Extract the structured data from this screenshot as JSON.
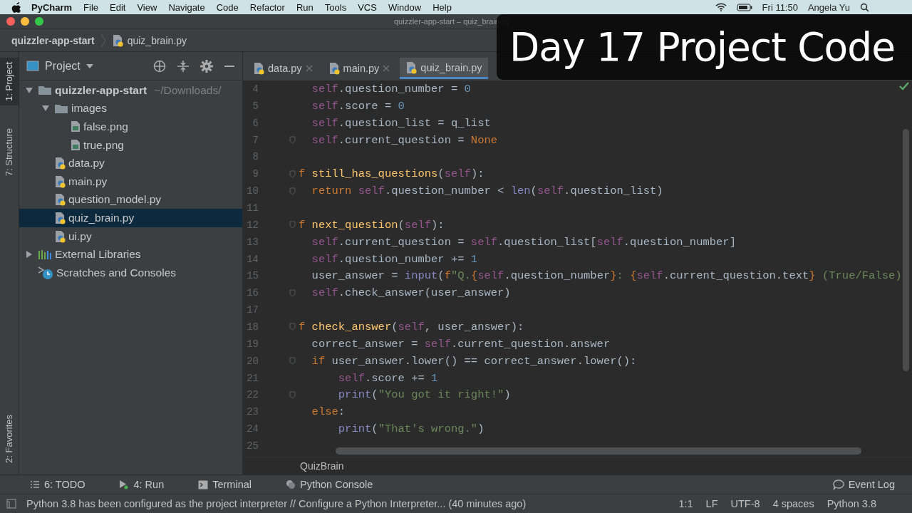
{
  "menubar": {
    "app": "PyCharm",
    "menus": [
      "File",
      "Edit",
      "View",
      "Navigate",
      "Code",
      "Refactor",
      "Run",
      "Tools",
      "VCS",
      "Window",
      "Help"
    ],
    "clock": "Fri 11:50",
    "user": "Angela Yu"
  },
  "window": {
    "title": "quizzler-app-start – quiz_brain.py"
  },
  "breadcrumb": [
    "quizzler-app-start",
    "quiz_brain.py"
  ],
  "side_tabs": [
    {
      "label": "1: Project",
      "kind": "top",
      "selected": true
    },
    {
      "label": "7: Structure",
      "kind": "top",
      "selected": false
    },
    {
      "label": "2: Favorites",
      "kind": "bottom",
      "selected": false
    }
  ],
  "project": {
    "title": "Project",
    "tree": [
      {
        "name": "quizzler-app-start",
        "hint": "~/Downloads/",
        "kind": "folder",
        "expanded": true,
        "selected": false,
        "children": [
          {
            "name": "images",
            "kind": "folder",
            "expanded": true,
            "selected": false,
            "children": [
              {
                "name": "false.png",
                "kind": "image",
                "selected": false
              },
              {
                "name": "true.png",
                "kind": "image",
                "selected": false
              }
            ]
          },
          {
            "name": "data.py",
            "kind": "python",
            "selected": false
          },
          {
            "name": "main.py",
            "kind": "python",
            "selected": false
          },
          {
            "name": "question_model.py",
            "kind": "python",
            "selected": false
          },
          {
            "name": "quiz_brain.py",
            "kind": "python",
            "selected": true
          },
          {
            "name": "ui.py",
            "kind": "python",
            "selected": false
          }
        ]
      },
      {
        "name": "External Libraries",
        "kind": "library",
        "expanded": false,
        "selected": false
      },
      {
        "name": "Scratches and Consoles",
        "kind": "scratches",
        "selected": false
      }
    ]
  },
  "editor": {
    "tabs": [
      {
        "label": "data.py",
        "selected": false
      },
      {
        "label": "main.py",
        "selected": false
      },
      {
        "label": "quiz_brain.py",
        "selected": true
      }
    ],
    "lines": [
      {
        "number": "4",
        "fold": false,
        "tokens": [
          {
            "kind": "self",
            "text": "  self"
          },
          {
            "kind": "plain",
            "text": ".question_number = "
          },
          {
            "kind": "number",
            "text": "0"
          }
        ]
      },
      {
        "number": "5",
        "fold": false,
        "tokens": [
          {
            "kind": "self",
            "text": "  self"
          },
          {
            "kind": "plain",
            "text": ".score = "
          },
          {
            "kind": "number",
            "text": "0"
          }
        ]
      },
      {
        "number": "6",
        "fold": false,
        "tokens": [
          {
            "kind": "self",
            "text": "  self"
          },
          {
            "kind": "plain",
            "text": ".question_list = q_list"
          }
        ]
      },
      {
        "number": "7",
        "fold": true,
        "tokens": [
          {
            "kind": "self",
            "text": "  self"
          },
          {
            "kind": "plain",
            "text": ".current_question = "
          },
          {
            "kind": "keyword",
            "text": "None"
          }
        ]
      },
      {
        "number": "8",
        "fold": false
      },
      {
        "number": "9",
        "fold": true,
        "tokens": [
          {
            "kind": "keyword",
            "text": "f "
          },
          {
            "kind": "defname",
            "text": "still_has_questions"
          },
          {
            "kind": "plain",
            "text": "("
          },
          {
            "kind": "self",
            "text": "self"
          },
          {
            "kind": "plain",
            "text": "):"
          }
        ]
      },
      {
        "number": "10",
        "fold": true,
        "tokens": [
          {
            "kind": "keyword",
            "text": "  return "
          },
          {
            "kind": "self",
            "text": "self"
          },
          {
            "kind": "plain",
            "text": ".question_number < "
          },
          {
            "kind": "builtin",
            "text": "len"
          },
          {
            "kind": "plain",
            "text": "("
          },
          {
            "kind": "self",
            "text": "self"
          },
          {
            "kind": "plain",
            "text": ".question_list)"
          }
        ]
      },
      {
        "number": "11",
        "fold": false
      },
      {
        "number": "12",
        "fold": true,
        "tokens": [
          {
            "kind": "keyword",
            "text": "f "
          },
          {
            "kind": "defname",
            "text": "next_question"
          },
          {
            "kind": "plain",
            "text": "("
          },
          {
            "kind": "self",
            "text": "self"
          },
          {
            "kind": "plain",
            "text": "):"
          }
        ]
      },
      {
        "number": "13",
        "fold": false,
        "tokens": [
          {
            "kind": "self",
            "text": "  self"
          },
          {
            "kind": "plain",
            "text": ".current_question = "
          },
          {
            "kind": "self",
            "text": "self"
          },
          {
            "kind": "plain",
            "text": ".question_list["
          },
          {
            "kind": "self",
            "text": "self"
          },
          {
            "kind": "plain",
            "text": ".question_number]"
          }
        ]
      },
      {
        "number": "14",
        "fold": false,
        "tokens": [
          {
            "kind": "self",
            "text": "  self"
          },
          {
            "kind": "plain",
            "text": ".question_number += "
          },
          {
            "kind": "number",
            "text": "1"
          }
        ]
      },
      {
        "number": "15",
        "fold": false,
        "tokens": [
          {
            "kind": "plain",
            "text": "  user_answer = "
          },
          {
            "kind": "builtin",
            "text": "input"
          },
          {
            "kind": "plain",
            "text": "("
          },
          {
            "kind": "keyword",
            "text": "f"
          },
          {
            "kind": "string",
            "text": "\"Q."
          },
          {
            "kind": "keyword",
            "text": "{"
          },
          {
            "kind": "self",
            "text": "self"
          },
          {
            "kind": "plain",
            "text": ".question_number"
          },
          {
            "kind": "keyword",
            "text": "}"
          },
          {
            "kind": "string",
            "text": ": "
          },
          {
            "kind": "keyword",
            "text": "{"
          },
          {
            "kind": "self",
            "text": "self"
          },
          {
            "kind": "plain",
            "text": ".current_question.text"
          },
          {
            "kind": "keyword",
            "text": "}"
          },
          {
            "kind": "string",
            "text": " (True/False)"
          }
        ]
      },
      {
        "number": "16",
        "fold": true,
        "tokens": [
          {
            "kind": "self",
            "text": "  self"
          },
          {
            "kind": "plain",
            "text": ".check_answer(user_answer)"
          }
        ]
      },
      {
        "number": "17",
        "fold": false
      },
      {
        "number": "18",
        "fold": true,
        "tokens": [
          {
            "kind": "keyword",
            "text": "f "
          },
          {
            "kind": "defname",
            "text": "check_answer"
          },
          {
            "kind": "plain",
            "text": "("
          },
          {
            "kind": "self",
            "text": "self"
          },
          {
            "kind": "plain",
            "text": ", user_answer):"
          }
        ]
      },
      {
        "number": "19",
        "fold": false,
        "tokens": [
          {
            "kind": "plain",
            "text": "  correct_answer = "
          },
          {
            "kind": "self",
            "text": "self"
          },
          {
            "kind": "plain",
            "text": ".current_question.answer"
          }
        ]
      },
      {
        "number": "20",
        "fold": true,
        "tokens": [
          {
            "kind": "keyword",
            "text": "  if "
          },
          {
            "kind": "plain",
            "text": "user_answer.lower() == correct_answer.lower():"
          }
        ]
      },
      {
        "number": "21",
        "fold": false,
        "tokens": [
          {
            "kind": "self",
            "text": "      self"
          },
          {
            "kind": "plain",
            "text": ".score += "
          },
          {
            "kind": "number",
            "text": "1"
          }
        ]
      },
      {
        "number": "22",
        "fold": true,
        "tokens": [
          {
            "kind": "builtin",
            "text": "      print"
          },
          {
            "kind": "plain",
            "text": "("
          },
          {
            "kind": "string",
            "text": "\"You got it right!\""
          },
          {
            "kind": "plain",
            "text": ")"
          }
        ]
      },
      {
        "number": "23",
        "fold": false,
        "tokens": [
          {
            "kind": "keyword",
            "text": "  else"
          },
          {
            "kind": "plain",
            "text": ":"
          }
        ]
      },
      {
        "number": "24",
        "fold": false,
        "tokens": [
          {
            "kind": "builtin",
            "text": "      print"
          },
          {
            "kind": "plain",
            "text": "("
          },
          {
            "kind": "string",
            "text": "\"That's wrong.\""
          },
          {
            "kind": "plain",
            "text": ")"
          }
        ]
      },
      {
        "number": "25",
        "fold": false
      }
    ],
    "breadcrumb": "QuizBrain"
  },
  "tool_tabs": [
    {
      "label": "6: TODO",
      "kind": "todo"
    },
    {
      "label": "4: Run",
      "kind": "run"
    },
    {
      "label": "Terminal",
      "kind": "terminal"
    },
    {
      "label": "Python Console",
      "kind": "console"
    }
  ],
  "event_log": "Event Log",
  "status_bar": {
    "message": "Python 3.8 has been configured as the project interpreter // Configure a Python Interpreter... (40 minutes ago)",
    "items": [
      "1:1",
      "LF",
      "UTF-8",
      "4 spaces",
      "Python 3.8"
    ]
  },
  "banner": "Day 17 Project Code"
}
